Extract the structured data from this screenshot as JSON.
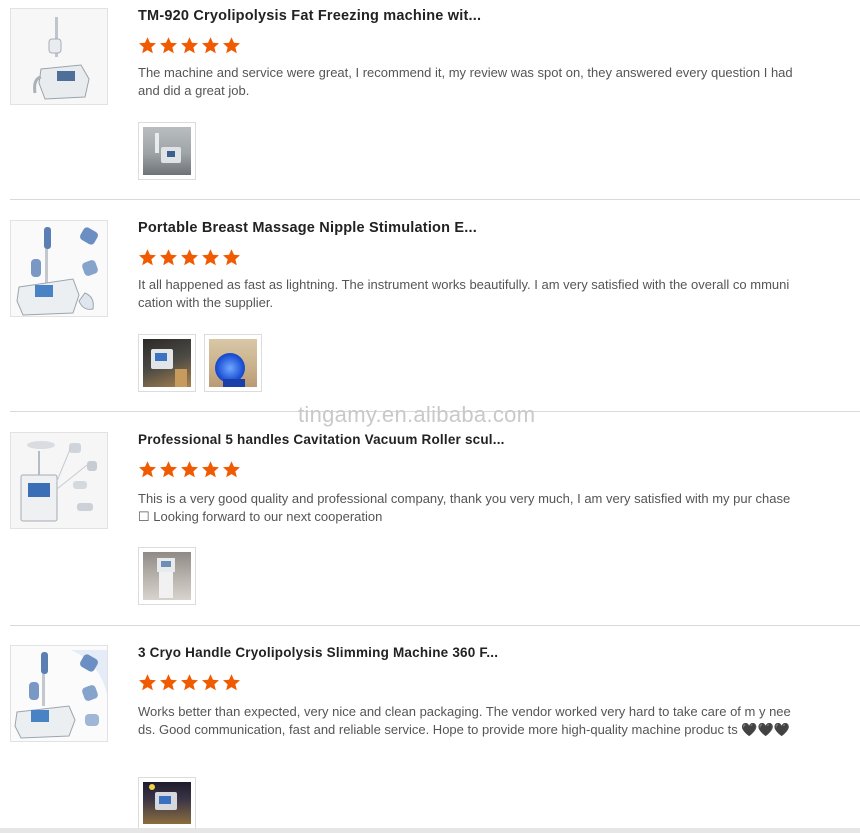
{
  "watermark": "tingamy.en.alibaba.com",
  "colors": {
    "star": "#f05a00",
    "divider": "#d9d9d9"
  },
  "reviews": [
    {
      "title": "TM-920 Cryolipolysis Fat Freezing machine wit...",
      "rating": 5,
      "text": "The machine and service were great, I recommend it, my review was spot on, they answered every question I had and did a great job.",
      "photos": 1
    },
    {
      "title": "Portable Breast Massage Nipple Stimulation E...",
      "rating": 5,
      "text": "It all happened as fast as lightning. The instrument works beautifully. I am very satisfied with the overall co mmunication with the supplier.",
      "photos": 2
    },
    {
      "title": "Professional 5 handles Cavitation Vacuum Roller scul...",
      "rating": 5,
      "text": "This is a very good quality and professional company, thank you very much, I am very satisfied with my pur chase ☐ Looking forward to our next cooperation",
      "photos": 1
    },
    {
      "title": "3 Cryo Handle Cryolipolysis Slimming Machine 360 F...",
      "rating": 5,
      "text": "Works better than expected, very nice and clean packaging. The vendor worked very hard to take care of m y needs. Good communication, fast and reliable service. Hope to provide more high-quality machine produc ts 🖤🖤🖤",
      "photos": 1
    }
  ]
}
